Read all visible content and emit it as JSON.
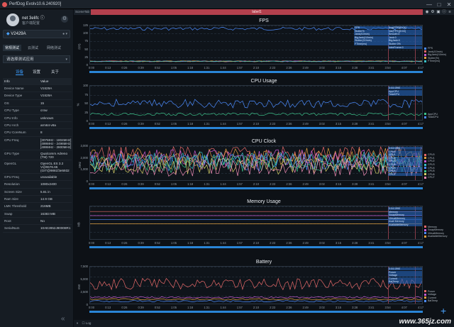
{
  "window": {
    "title": "PerfDog Evolv10.6.240920]",
    "minimize": "—",
    "maximize": "□",
    "close": "✕"
  },
  "user": {
    "name": "net 3elifc",
    "status_icon": "info-icon",
    "subtitle": "客户端配置",
    "settings_icon": "gear-icon"
  },
  "device": {
    "selected": "V2429A",
    "dropdown_icon": "chevron-down-icon"
  },
  "mode_tabs": [
    "常规测试",
    "云测试",
    "网络测试"
  ],
  "mode_active": 0,
  "app_select": {
    "placeholder": "请选择测试应用"
  },
  "info_tabs": [
    "设备",
    "设置",
    "关于"
  ],
  "info_active": 0,
  "info_table": {
    "headers": [
      "Info",
      "Value"
    ],
    "rows": [
      {
        "k": "Device Name",
        "v": "V2429A"
      },
      {
        "k": "Device Type",
        "v": "V2429A"
      },
      {
        "k": "OS",
        "v": "15"
      },
      {
        "k": "CPU Type",
        "v": "crow"
      },
      {
        "k": "CPU Info",
        "v": "unknown"
      },
      {
        "k": "CPU Arch",
        "v": "arm64-v8a"
      },
      {
        "k": "CPU CoreNum",
        "v": "8"
      },
      {
        "k": "CPU Freq",
        "v": "[307MHz - 1804MHz]\n[499MHz - 2496MHz]\n[499MHz - 2800MHz]"
      },
      {
        "k": "GPU Type",
        "v": "Qualcomm Adreno\n(TM) 720"
      },
      {
        "k": "OpenGL",
        "v": "OpenGL ES 3.2\nV@0676.65\n(GIT@9881f3e5932"
      },
      {
        "k": "GPU Freq",
        "v": "unavailable"
      },
      {
        "k": "Resolution",
        "v": "1080x2400"
      },
      {
        "k": "Screen Size",
        "v": "5.81 in"
      },
      {
        "k": "Ram Size",
        "v": "14.9 GB"
      },
      {
        "k": "LMK Threshold",
        "v": "216MB"
      },
      {
        "k": "Swap",
        "v": "16383 MB"
      },
      {
        "k": "Root",
        "v": "No"
      },
      {
        "k": "SerialNum",
        "v": "10AE2852J90008R1"
      }
    ]
  },
  "tabstrip": {
    "tab_label": "SceneTab",
    "label_bar": "label1"
  },
  "toolbar_icons": [
    "location-icon",
    "settings-icon",
    "camera-icon",
    "info-icon",
    "menu-icon"
  ],
  "x_ticks": [
    "0:00",
    "0:13",
    "0:26",
    "0:39",
    "0:52",
    "1:05",
    "1:18",
    "1:31",
    "1:44",
    "1:57",
    "2:10",
    "2:23",
    "2:36",
    "2:49",
    "3:02",
    "3:15",
    "3:28",
    "3:41",
    "3:54",
    "4:07",
    "4:17"
  ],
  "panels": [
    {
      "id": "fps",
      "title": "FPS",
      "unit": "FPS",
      "y_ticks": [
        "125",
        "100",
        "75",
        "50",
        "25",
        "0"
      ],
      "hover": [
        "Avg(FPS)[0:04]",
        "Var(FPS)[0:04]",
        "Smooth:0",
        "Jank:0",
        "BigJank:0",
        "Stutter:0%",
        "InterFrame:0"
      ],
      "hover2": [
        "FPS",
        "Stutter%",
        "Jank(/10min)",
        "BigJank(/10min)",
        "Stutter(/10min)",
        "FTime(ms)"
      ],
      "legend": [
        {
          "label": "FPS",
          "color": "#4c8cff"
        },
        {
          "label": "Jank(/10min)",
          "color": "#e86a6a"
        },
        {
          "label": "BigJank(/10min)",
          "color": "#c85ad2"
        },
        {
          "label": "Stutter(%)",
          "color": "#e0a040"
        },
        {
          "label": "FTime(ms)",
          "color": "#38c2c8"
        }
      ]
    },
    {
      "id": "cpu",
      "title": "CPU Usage",
      "unit": "%",
      "y_ticks": [
        "100",
        "75",
        "50",
        "25",
        "0"
      ],
      "hover": [
        "0:04:1990",
        "AppCPU",
        "TotalCPU"
      ],
      "legend": [
        {
          "label": "AppCPU",
          "color": "#3cc28a"
        },
        {
          "label": "TotalCPU",
          "color": "#4c8cff"
        }
      ]
    },
    {
      "id": "cpuclock",
      "title": "CPU Clock",
      "unit": "MHz",
      "y_ticks": [
        "3,000",
        "2,000",
        "1,000",
        "0"
      ],
      "hover": [
        "0:04:1990",
        "CPU0",
        "CPU1",
        "CPU2",
        "CPU3",
        "CPU4",
        "CPU5",
        "CPU6",
        "CPU7"
      ],
      "legend": [
        {
          "label": "CPU0",
          "color": "#e86a6a"
        },
        {
          "label": "CPU1",
          "color": "#e0a040"
        },
        {
          "label": "CPU2",
          "color": "#c85ad2"
        },
        {
          "label": "CPU3",
          "color": "#38c2c8"
        },
        {
          "label": "CPU4",
          "color": "#4c8cff"
        },
        {
          "label": "CPU5",
          "color": "#3cc28a"
        },
        {
          "label": "CPU6",
          "color": "#d8d26a"
        },
        {
          "label": "CPU7",
          "color": "#f08bb4"
        }
      ]
    },
    {
      "id": "memory",
      "title": "Memory Usage",
      "unit": "MB",
      "y_ticks": [],
      "hover": [
        "0:04:1990",
        "Memory",
        "SwapMemory",
        "VirtualMemory",
        "Avail Memory",
        "AvailableMemory"
      ],
      "legend": [
        {
          "label": "Memory",
          "color": "#e86a6a"
        },
        {
          "label": "SwapMemory",
          "color": "#c85ad2"
        },
        {
          "label": "VirtualMemory",
          "color": "#4c8cff"
        },
        {
          "label": "AvailableMemory",
          "color": "#e0a040"
        }
      ]
    },
    {
      "id": "battery",
      "title": "Battery",
      "unit": "mW",
      "y_ticks": [
        "7,500",
        "5,000",
        "2,500",
        "0"
      ],
      "hover": [
        "0:04:1990",
        "Power",
        "Voltage",
        "Current",
        "BatTemp"
      ],
      "legend": [
        {
          "label": "Power",
          "color": "#e86a6a"
        },
        {
          "label": "Voltage",
          "color": "#c85ad2"
        },
        {
          "label": "Current",
          "color": "#e0a040"
        },
        {
          "label": "BatTemp",
          "color": "#4c8cff"
        }
      ]
    }
  ],
  "bottom": {
    "log_label": "Log"
  },
  "watermark": "www.365jz.com"
}
